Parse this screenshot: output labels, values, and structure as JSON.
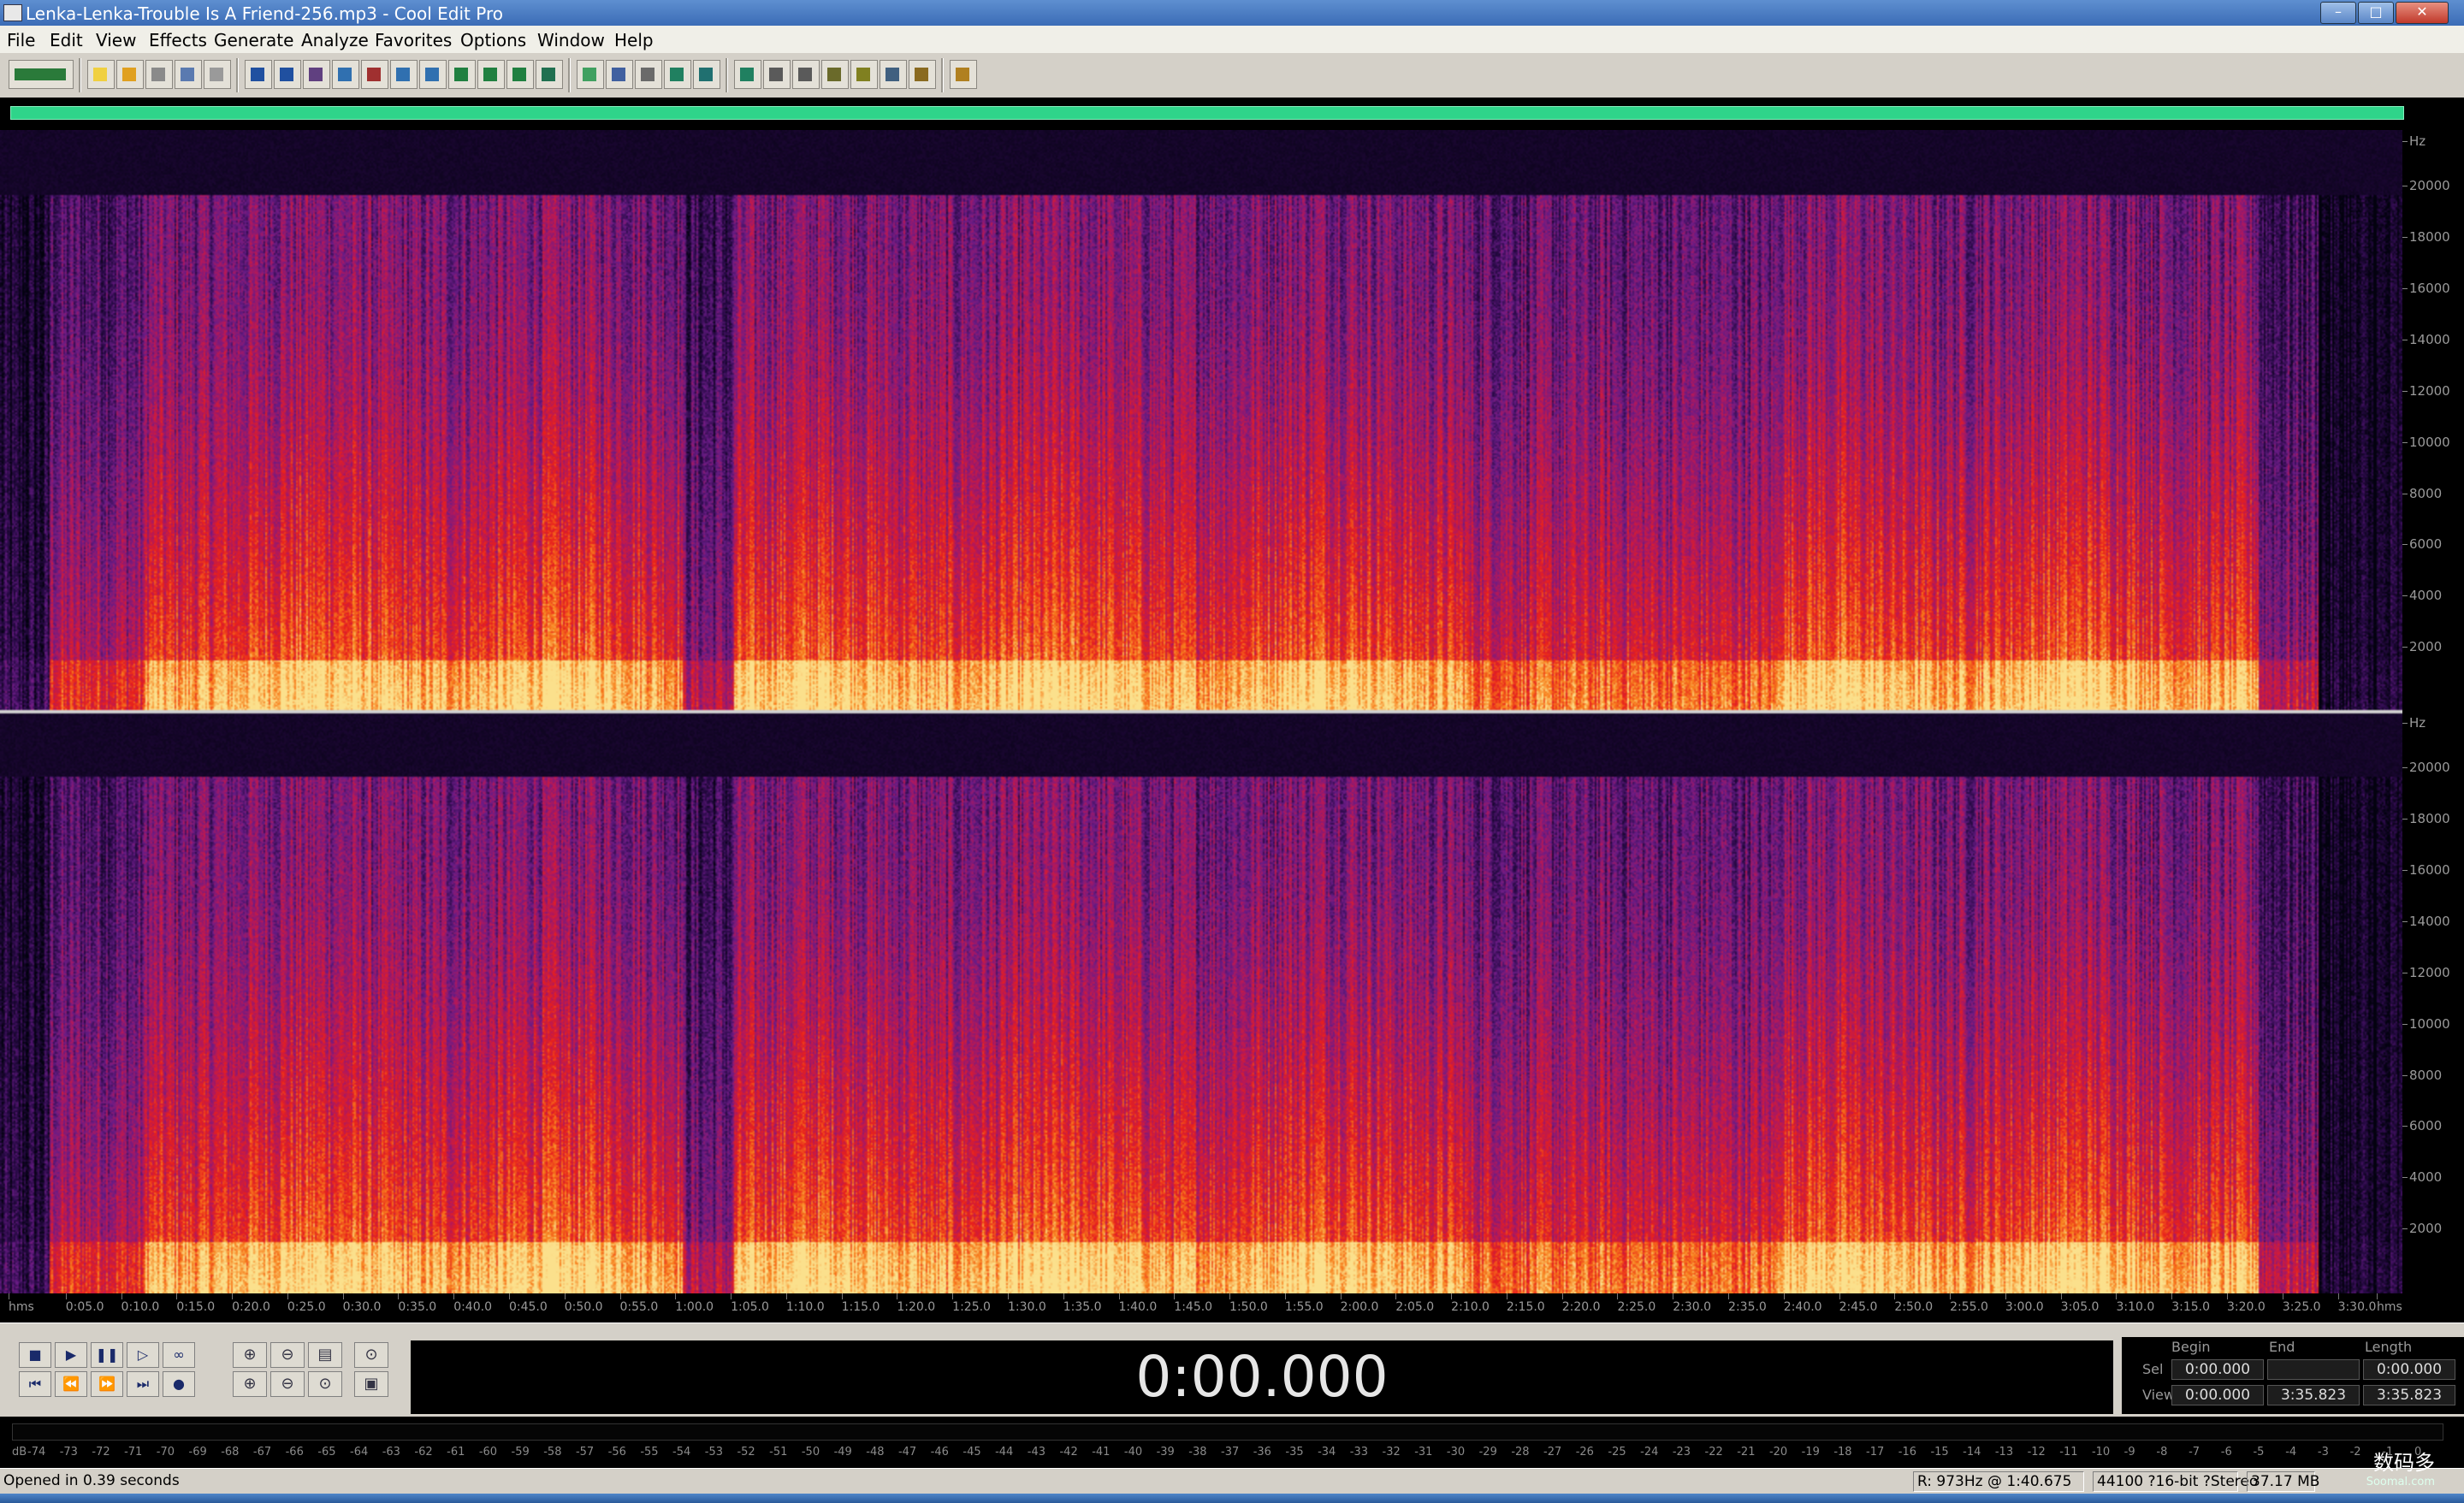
{
  "window": {
    "title": "Lenka-Lenka-Trouble Is A Friend-256.mp3 - Cool Edit Pro",
    "min_label": "–",
    "max_label": "□",
    "close_label": "✕"
  },
  "menu": [
    "File",
    "Edit",
    "View",
    "Effects",
    "Generate",
    "Analyze",
    "Favorites",
    "Options",
    "Window",
    "Help"
  ],
  "toolbar": {
    "icons": [
      "multitrack-toggle-icon",
      "new-file-icon",
      "open-file-icon",
      "save-file-icon",
      "save-all-icon",
      "close-file-icon",
      "undo-icon",
      "redo-icon",
      "repeat-last-icon",
      "copy-new-icon",
      "cut-icon",
      "copy-icon",
      "paste-icon",
      "paste-new-icon",
      "mix-paste-icon",
      "loop-icon",
      "cd-icon",
      "spectral-view-icon",
      "waveform-view-icon",
      "cue-list-icon",
      "play-list-icon",
      "snap-icon",
      "envelope-icon",
      "grid-icon",
      "frequency-analysis-icon",
      "scripts-icon",
      "batch-icon",
      "tool-icon",
      "stats-icon",
      "help-icon"
    ]
  },
  "spectrogram": {
    "channels": 2,
    "palette": [
      "#03020f",
      "#2a0a48",
      "#6a1c86",
      "#b2185c",
      "#e8201c",
      "#f8801c",
      "#fbe08c"
    ]
  },
  "frequency_axis": {
    "unit": "Hz",
    "labels": [
      "20000",
      "18000",
      "16000",
      "14000",
      "12000",
      "10000",
      "8000",
      "6000",
      "4000",
      "2000"
    ]
  },
  "time_ruler": {
    "start_label": "hms",
    "end_label": "hms",
    "ticks": [
      "0:05.0",
      "0:10.0",
      "0:15.0",
      "0:20.0",
      "0:25.0",
      "0:30.0",
      "0:35.0",
      "0:40.0",
      "0:45.0",
      "0:50.0",
      "0:55.0",
      "1:00.0",
      "1:05.0",
      "1:10.0",
      "1:15.0",
      "1:20.0",
      "1:25.0",
      "1:30.0",
      "1:35.0",
      "1:40.0",
      "1:45.0",
      "1:50.0",
      "1:55.0",
      "2:00.0",
      "2:05.0",
      "2:10.0",
      "2:15.0",
      "2:20.0",
      "2:25.0",
      "2:30.0",
      "2:35.0",
      "2:40.0",
      "2:45.0",
      "2:50.0",
      "2:55.0",
      "3:00.0",
      "3:05.0",
      "3:10.0",
      "3:15.0",
      "3:20.0",
      "3:25.0",
      "3:30.0"
    ]
  },
  "transport": {
    "row1": [
      "■",
      "▶",
      "❚❚",
      "▷",
      "∞"
    ],
    "row1_names": [
      "stop-button",
      "play-button",
      "pause-button",
      "play-to-end-button",
      "loop-play-button"
    ],
    "row2": [
      "⏮",
      "⏪",
      "⏩",
      "⏭",
      "●"
    ],
    "row2_names": [
      "go-to-start-button",
      "rewind-button",
      "fast-forward-button",
      "go-to-end-button",
      "record-button"
    ],
    "zoom_row1": [
      "⊕",
      "⊖",
      "▤",
      "⊙"
    ],
    "zoom_row2": [
      "⊕",
      "⊖",
      "⊙",
      "▣"
    ]
  },
  "time_display": "0:00.000",
  "selection": {
    "headers": [
      "Begin",
      "End",
      "Length"
    ],
    "sel_label": "Sel",
    "view_label": "View",
    "sel": [
      "0:00.000",
      "",
      "0:00.000"
    ],
    "view": [
      "0:00.000",
      "3:35.823",
      "3:35.823"
    ]
  },
  "level_meter": {
    "unit": "dB",
    "labels": [
      "-74",
      "-73",
      "-72",
      "-71",
      "-70",
      "-69",
      "-68",
      "-67",
      "-66",
      "-65",
      "-64",
      "-63",
      "-62",
      "-61",
      "-60",
      "-59",
      "-58",
      "-57",
      "-56",
      "-55",
      "-54",
      "-53",
      "-52",
      "-51",
      "-50",
      "-49",
      "-48",
      "-47",
      "-46",
      "-45",
      "-44",
      "-43",
      "-42",
      "-41",
      "-40",
      "-39",
      "-38",
      "-37",
      "-36",
      "-35",
      "-34",
      "-33",
      "-32",
      "-31",
      "-30",
      "-29",
      "-28",
      "-27",
      "-26",
      "-25",
      "-24",
      "-23",
      "-22",
      "-21",
      "-20",
      "-19",
      "-18",
      "-17",
      "-16",
      "-15",
      "-14",
      "-13",
      "-12",
      "-11",
      "-10",
      "-9",
      "-8",
      "-7",
      "-6",
      "-5",
      "-4",
      "-3",
      "-2",
      "-1",
      "0"
    ]
  },
  "status": {
    "message": "Opened in 0.39 seconds",
    "cursor": "R: 973Hz @  1:40.675",
    "format": "44100 ?16-bit ?Stereo",
    "size": "37.17 MB"
  },
  "watermark": {
    "text": "数码多",
    "sub": "Soomal.com"
  }
}
